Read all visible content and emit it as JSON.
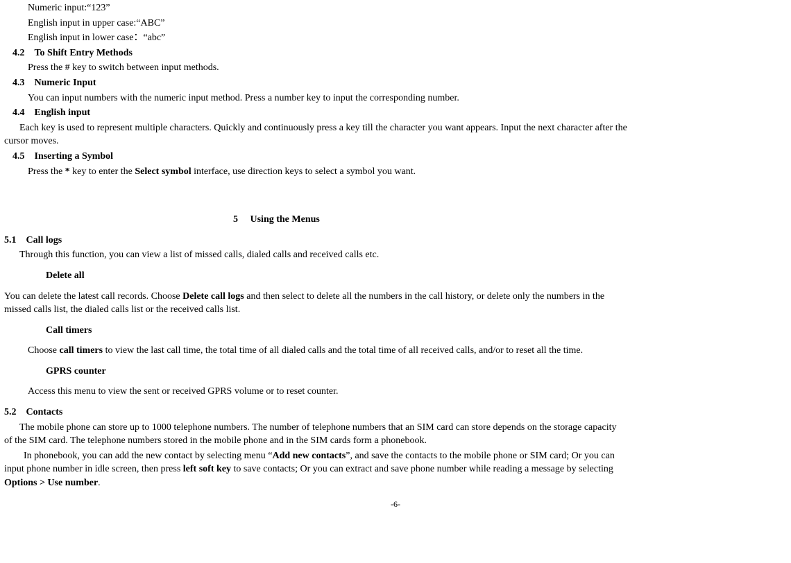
{
  "top": {
    "line1": "Numeric input:“123”",
    "line2": "English input in upper case:“ABC”",
    "line3": "English input in lower case：“abc”"
  },
  "s42": {
    "heading": "4.2 To Shift Entry Methods",
    "body": "Press the # key to switch between input methods."
  },
  "s43": {
    "heading": "4.3 Numeric Input",
    "body": "You can input numbers with the numeric input method. Press a number key to input the corresponding number."
  },
  "s44": {
    "heading": "4.4 English input",
    "body1a": "Each key is used to represent multiple characters. Quickly and continuously press a key till the character you want appears. Input the next character after the",
    "body1b": "cursor moves."
  },
  "s45": {
    "heading": "4.5 Inserting a Symbol",
    "b1": "Press the ",
    "b2": "*",
    "b3": " key to enter the ",
    "b4": "Select symbol",
    "b5": " interface, use direction keys to select a symbol you want."
  },
  "chapter5": "5  Using the Menus",
  "s51": {
    "heading": "5.1 Call logs",
    "intro": "Through this function, you can view a list of missed calls, dialed calls and received calls etc.",
    "deleteall_h": "Delete all",
    "deleteall_a": "You can delete the latest call records. Choose ",
    "deleteall_b": "Delete call logs",
    "deleteall_c": " and then select to delete all the numbers in the call history, or delete only the numbers in the",
    "deleteall_d": "missed calls list, the dialed calls list or the received calls list.",
    "calltimers_h": "Call timers",
    "calltimers_a": "Choose ",
    "calltimers_b": "call timers",
    "calltimers_c": " to view the last call time, the total time of all dialed calls and the total time of all received calls, and/or to reset all the time.",
    "gprs_h": "GPRS counter",
    "gprs_body": "Access this menu to view the sent or received GPRS volume or to reset counter."
  },
  "s52": {
    "heading": "5.2 Contacts",
    "p1a": "The mobile phone can store up to 1000 telephone numbers. The number of telephone numbers that an SIM card can store depends on the storage capacity",
    "p1b": "of the SIM card. The telephone numbers stored in the mobile phone and in the SIM cards form a phonebook.",
    "p2a": "In phonebook, you can add the new contact by selecting menu “",
    "p2b": "Add new contacts",
    "p2c": "”, and save the contacts to the mobile phone or SIM card; Or you can",
    "p2d": "input phone number in idle screen, then press ",
    "p2e": "left soft key",
    "p2f": " to save contacts; Or you can extract and save phone number while reading a message by selecting",
    "p2g": "Options > Use number",
    "p2h": "."
  },
  "footer": "-6-"
}
